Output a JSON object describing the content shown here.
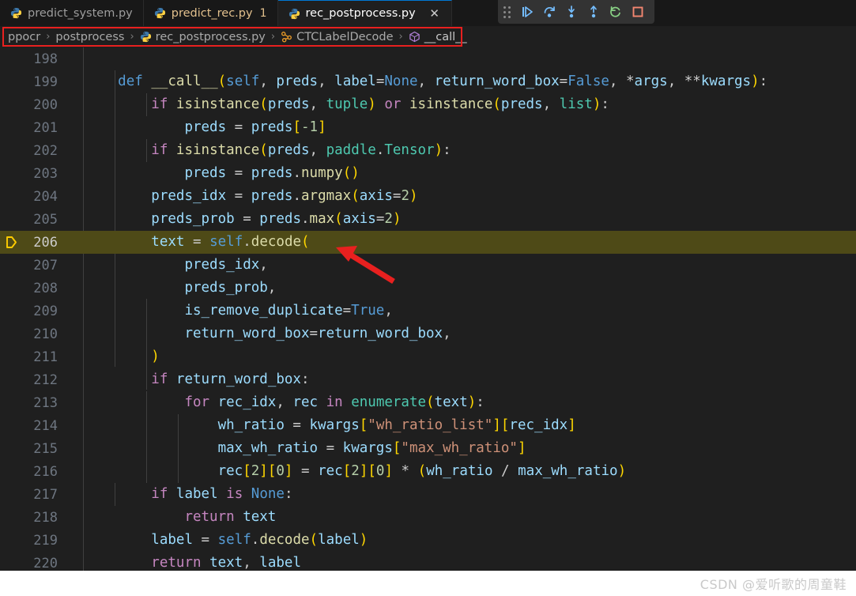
{
  "editor": {
    "theme_bg": "#1f1f1f",
    "tabbar_bg": "#181818",
    "current_line_bg": "#4e4a17",
    "accent": "#0078d4",
    "tabs": [
      {
        "label": "predict_system.py",
        "icon": "python-icon",
        "state": "inactive",
        "badge": ""
      },
      {
        "label": "predict_rec.py",
        "icon": "python-icon",
        "state": "modified",
        "badge": "1"
      },
      {
        "label": "rec_postprocess.py",
        "icon": "python-icon",
        "state": "active",
        "badge": "",
        "close": "✕"
      }
    ],
    "breadcrumb": [
      {
        "label": "ppocr",
        "icon": ""
      },
      {
        "label": "postprocess",
        "icon": ""
      },
      {
        "label": "rec_postprocess.py",
        "icon": "python-icon"
      },
      {
        "label": "CTCLabelDecode",
        "icon": "class-icon"
      },
      {
        "label": "__call__",
        "icon": "method-icon"
      }
    ],
    "breadcrumb_separator": "›",
    "current_line": 206,
    "first_line": 198,
    "lines": [
      {
        "n": 198,
        "tokens": []
      },
      {
        "n": 199,
        "tokens": [
          {
            "t": "    ",
            "c": "pn"
          },
          {
            "t": "def",
            "c": "k"
          },
          {
            "t": " ",
            "c": "pn"
          },
          {
            "t": "__call__",
            "c": "fn"
          },
          {
            "t": "(",
            "c": "br"
          },
          {
            "t": "self",
            "c": "k"
          },
          {
            "t": ", ",
            "c": "pn"
          },
          {
            "t": "preds",
            "c": "va"
          },
          {
            "t": ", ",
            "c": "pn"
          },
          {
            "t": "label",
            "c": "va"
          },
          {
            "t": "=",
            "c": "op"
          },
          {
            "t": "None",
            "c": "k"
          },
          {
            "t": ", ",
            "c": "pn"
          },
          {
            "t": "return_word_box",
            "c": "va"
          },
          {
            "t": "=",
            "c": "op"
          },
          {
            "t": "False",
            "c": "k"
          },
          {
            "t": ", ",
            "c": "pn"
          },
          {
            "t": "*",
            "c": "op"
          },
          {
            "t": "args",
            "c": "va"
          },
          {
            "t": ", ",
            "c": "pn"
          },
          {
            "t": "**",
            "c": "op"
          },
          {
            "t": "kwargs",
            "c": "va"
          },
          {
            "t": ")",
            "c": "br"
          },
          {
            "t": ":",
            "c": "pn"
          }
        ]
      },
      {
        "n": 200,
        "tokens": [
          {
            "t": "        ",
            "c": "pn"
          },
          {
            "t": "if",
            "c": "kc"
          },
          {
            "t": " ",
            "c": "pn"
          },
          {
            "t": "isinstance",
            "c": "fn"
          },
          {
            "t": "(",
            "c": "br"
          },
          {
            "t": "preds",
            "c": "va"
          },
          {
            "t": ", ",
            "c": "pn"
          },
          {
            "t": "tuple",
            "c": "ty"
          },
          {
            "t": ")",
            "c": "br"
          },
          {
            "t": " ",
            "c": "pn"
          },
          {
            "t": "or",
            "c": "kc"
          },
          {
            "t": " ",
            "c": "pn"
          },
          {
            "t": "isinstance",
            "c": "fn"
          },
          {
            "t": "(",
            "c": "br"
          },
          {
            "t": "preds",
            "c": "va"
          },
          {
            "t": ", ",
            "c": "pn"
          },
          {
            "t": "list",
            "c": "ty"
          },
          {
            "t": ")",
            "c": "br"
          },
          {
            "t": ":",
            "c": "pn"
          }
        ]
      },
      {
        "n": 201,
        "tokens": [
          {
            "t": "            ",
            "c": "pn"
          },
          {
            "t": "preds",
            "c": "va"
          },
          {
            "t": " ",
            "c": "pn"
          },
          {
            "t": "=",
            "c": "op"
          },
          {
            "t": " ",
            "c": "pn"
          },
          {
            "t": "preds",
            "c": "va"
          },
          {
            "t": "[",
            "c": "br"
          },
          {
            "t": "-1",
            "c": "nu"
          },
          {
            "t": "]",
            "c": "br"
          }
        ]
      },
      {
        "n": 202,
        "tokens": [
          {
            "t": "        ",
            "c": "pn"
          },
          {
            "t": "if",
            "c": "kc"
          },
          {
            "t": " ",
            "c": "pn"
          },
          {
            "t": "isinstance",
            "c": "fn"
          },
          {
            "t": "(",
            "c": "br"
          },
          {
            "t": "preds",
            "c": "va"
          },
          {
            "t": ", ",
            "c": "pn"
          },
          {
            "t": "paddle",
            "c": "ty"
          },
          {
            "t": ".",
            "c": "pn"
          },
          {
            "t": "Tensor",
            "c": "ty"
          },
          {
            "t": ")",
            "c": "br"
          },
          {
            "t": ":",
            "c": "pn"
          }
        ]
      },
      {
        "n": 203,
        "tokens": [
          {
            "t": "            ",
            "c": "pn"
          },
          {
            "t": "preds",
            "c": "va"
          },
          {
            "t": " ",
            "c": "pn"
          },
          {
            "t": "=",
            "c": "op"
          },
          {
            "t": " ",
            "c": "pn"
          },
          {
            "t": "preds",
            "c": "va"
          },
          {
            "t": ".",
            "c": "pn"
          },
          {
            "t": "numpy",
            "c": "fn"
          },
          {
            "t": "()",
            "c": "br"
          }
        ]
      },
      {
        "n": 204,
        "tokens": [
          {
            "t": "        ",
            "c": "pn"
          },
          {
            "t": "preds_idx",
            "c": "va"
          },
          {
            "t": " ",
            "c": "pn"
          },
          {
            "t": "=",
            "c": "op"
          },
          {
            "t": " ",
            "c": "pn"
          },
          {
            "t": "preds",
            "c": "va"
          },
          {
            "t": ".",
            "c": "pn"
          },
          {
            "t": "argmax",
            "c": "fn"
          },
          {
            "t": "(",
            "c": "br"
          },
          {
            "t": "axis",
            "c": "va"
          },
          {
            "t": "=",
            "c": "op"
          },
          {
            "t": "2",
            "c": "nu"
          },
          {
            "t": ")",
            "c": "br"
          }
        ]
      },
      {
        "n": 205,
        "tokens": [
          {
            "t": "        ",
            "c": "pn"
          },
          {
            "t": "preds_prob",
            "c": "va"
          },
          {
            "t": " ",
            "c": "pn"
          },
          {
            "t": "=",
            "c": "op"
          },
          {
            "t": " ",
            "c": "pn"
          },
          {
            "t": "preds",
            "c": "va"
          },
          {
            "t": ".",
            "c": "pn"
          },
          {
            "t": "max",
            "c": "fn"
          },
          {
            "t": "(",
            "c": "br"
          },
          {
            "t": "axis",
            "c": "va"
          },
          {
            "t": "=",
            "c": "op"
          },
          {
            "t": "2",
            "c": "nu"
          },
          {
            "t": ")",
            "c": "br"
          }
        ]
      },
      {
        "n": 206,
        "tokens": [
          {
            "t": "        ",
            "c": "pn"
          },
          {
            "t": "text",
            "c": "va"
          },
          {
            "t": " ",
            "c": "pn"
          },
          {
            "t": "=",
            "c": "op"
          },
          {
            "t": " ",
            "c": "pn"
          },
          {
            "t": "self",
            "c": "k"
          },
          {
            "t": ".",
            "c": "pn"
          },
          {
            "t": "decode",
            "c": "fn"
          },
          {
            "t": "(",
            "c": "br"
          }
        ]
      },
      {
        "n": 207,
        "tokens": [
          {
            "t": "            ",
            "c": "pn"
          },
          {
            "t": "preds_idx",
            "c": "va"
          },
          {
            "t": ",",
            "c": "pn"
          }
        ]
      },
      {
        "n": 208,
        "tokens": [
          {
            "t": "            ",
            "c": "pn"
          },
          {
            "t": "preds_prob",
            "c": "va"
          },
          {
            "t": ",",
            "c": "pn"
          }
        ]
      },
      {
        "n": 209,
        "tokens": [
          {
            "t": "            ",
            "c": "pn"
          },
          {
            "t": "is_remove_duplicate",
            "c": "va"
          },
          {
            "t": "=",
            "c": "op"
          },
          {
            "t": "True",
            "c": "k"
          },
          {
            "t": ",",
            "c": "pn"
          }
        ]
      },
      {
        "n": 210,
        "tokens": [
          {
            "t": "            ",
            "c": "pn"
          },
          {
            "t": "return_word_box",
            "c": "va"
          },
          {
            "t": "=",
            "c": "op"
          },
          {
            "t": "return_word_box",
            "c": "va"
          },
          {
            "t": ",",
            "c": "pn"
          }
        ]
      },
      {
        "n": 211,
        "tokens": [
          {
            "t": "        ",
            "c": "pn"
          },
          {
            "t": ")",
            "c": "br"
          }
        ]
      },
      {
        "n": 212,
        "tokens": [
          {
            "t": "        ",
            "c": "pn"
          },
          {
            "t": "if",
            "c": "kc"
          },
          {
            "t": " ",
            "c": "pn"
          },
          {
            "t": "return_word_box",
            "c": "va"
          },
          {
            "t": ":",
            "c": "pn"
          }
        ]
      },
      {
        "n": 213,
        "tokens": [
          {
            "t": "            ",
            "c": "pn"
          },
          {
            "t": "for",
            "c": "kc"
          },
          {
            "t": " ",
            "c": "pn"
          },
          {
            "t": "rec_idx",
            "c": "va"
          },
          {
            "t": ", ",
            "c": "pn"
          },
          {
            "t": "rec",
            "c": "va"
          },
          {
            "t": " ",
            "c": "pn"
          },
          {
            "t": "in",
            "c": "kc"
          },
          {
            "t": " ",
            "c": "pn"
          },
          {
            "t": "enumerate",
            "c": "ty"
          },
          {
            "t": "(",
            "c": "br"
          },
          {
            "t": "text",
            "c": "va"
          },
          {
            "t": ")",
            "c": "br"
          },
          {
            "t": ":",
            "c": "pn"
          }
        ]
      },
      {
        "n": 214,
        "tokens": [
          {
            "t": "                ",
            "c": "pn"
          },
          {
            "t": "wh_ratio",
            "c": "va"
          },
          {
            "t": " ",
            "c": "pn"
          },
          {
            "t": "=",
            "c": "op"
          },
          {
            "t": " ",
            "c": "pn"
          },
          {
            "t": "kwargs",
            "c": "va"
          },
          {
            "t": "[",
            "c": "br"
          },
          {
            "t": "\"wh_ratio_list\"",
            "c": "st"
          },
          {
            "t": "]",
            "c": "br"
          },
          {
            "t": "[",
            "c": "br"
          },
          {
            "t": "rec_idx",
            "c": "va"
          },
          {
            "t": "]",
            "c": "br"
          }
        ]
      },
      {
        "n": 215,
        "tokens": [
          {
            "t": "                ",
            "c": "pn"
          },
          {
            "t": "max_wh_ratio",
            "c": "va"
          },
          {
            "t": " ",
            "c": "pn"
          },
          {
            "t": "=",
            "c": "op"
          },
          {
            "t": " ",
            "c": "pn"
          },
          {
            "t": "kwargs",
            "c": "va"
          },
          {
            "t": "[",
            "c": "br"
          },
          {
            "t": "\"max_wh_ratio\"",
            "c": "st"
          },
          {
            "t": "]",
            "c": "br"
          }
        ]
      },
      {
        "n": 216,
        "tokens": [
          {
            "t": "                ",
            "c": "pn"
          },
          {
            "t": "rec",
            "c": "va"
          },
          {
            "t": "[",
            "c": "br"
          },
          {
            "t": "2",
            "c": "nu"
          },
          {
            "t": "]",
            "c": "br"
          },
          {
            "t": "[",
            "c": "br"
          },
          {
            "t": "0",
            "c": "nu"
          },
          {
            "t": "]",
            "c": "br"
          },
          {
            "t": " ",
            "c": "pn"
          },
          {
            "t": "=",
            "c": "op"
          },
          {
            "t": " ",
            "c": "pn"
          },
          {
            "t": "rec",
            "c": "va"
          },
          {
            "t": "[",
            "c": "br"
          },
          {
            "t": "2",
            "c": "nu"
          },
          {
            "t": "]",
            "c": "br"
          },
          {
            "t": "[",
            "c": "br"
          },
          {
            "t": "0",
            "c": "nu"
          },
          {
            "t": "]",
            "c": "br"
          },
          {
            "t": " ",
            "c": "pn"
          },
          {
            "t": "*",
            "c": "op"
          },
          {
            "t": " ",
            "c": "pn"
          },
          {
            "t": "(",
            "c": "br"
          },
          {
            "t": "wh_ratio",
            "c": "va"
          },
          {
            "t": " ",
            "c": "pn"
          },
          {
            "t": "/",
            "c": "op"
          },
          {
            "t": " ",
            "c": "pn"
          },
          {
            "t": "max_wh_ratio",
            "c": "va"
          },
          {
            "t": ")",
            "c": "br"
          }
        ]
      },
      {
        "n": 217,
        "tokens": [
          {
            "t": "        ",
            "c": "pn"
          },
          {
            "t": "if",
            "c": "kc"
          },
          {
            "t": " ",
            "c": "pn"
          },
          {
            "t": "label",
            "c": "va"
          },
          {
            "t": " ",
            "c": "pn"
          },
          {
            "t": "is",
            "c": "kc"
          },
          {
            "t": " ",
            "c": "pn"
          },
          {
            "t": "None",
            "c": "k"
          },
          {
            "t": ":",
            "c": "pn"
          }
        ]
      },
      {
        "n": 218,
        "tokens": [
          {
            "t": "            ",
            "c": "pn"
          },
          {
            "t": "return",
            "c": "kc"
          },
          {
            "t": " ",
            "c": "pn"
          },
          {
            "t": "text",
            "c": "va"
          }
        ]
      },
      {
        "n": 219,
        "tokens": [
          {
            "t": "        ",
            "c": "pn"
          },
          {
            "t": "label",
            "c": "va"
          },
          {
            "t": " ",
            "c": "pn"
          },
          {
            "t": "=",
            "c": "op"
          },
          {
            "t": " ",
            "c": "pn"
          },
          {
            "t": "self",
            "c": "k"
          },
          {
            "t": ".",
            "c": "pn"
          },
          {
            "t": "decode",
            "c": "fn"
          },
          {
            "t": "(",
            "c": "br"
          },
          {
            "t": "label",
            "c": "va"
          },
          {
            "t": ")",
            "c": "br"
          }
        ]
      },
      {
        "n": 220,
        "tokens": [
          {
            "t": "        ",
            "c": "pn"
          },
          {
            "t": "return",
            "c": "kc"
          },
          {
            "t": " ",
            "c": "pn"
          },
          {
            "t": "text",
            "c": "va"
          },
          {
            "t": ", ",
            "c": "pn"
          },
          {
            "t": "label",
            "c": "va"
          }
        ]
      }
    ]
  },
  "debug_toolbar": {
    "buttons": [
      {
        "name": "drag-handle",
        "title": "Drag",
        "icon": "grip-icon"
      },
      {
        "name": "continue-button",
        "title": "Continue",
        "icon": "continue-icon"
      },
      {
        "name": "step-over-button",
        "title": "Step Over",
        "icon": "step-over-icon"
      },
      {
        "name": "step-into-button",
        "title": "Step Into",
        "icon": "step-into-icon"
      },
      {
        "name": "step-out-button",
        "title": "Step Out",
        "icon": "step-out-icon"
      },
      {
        "name": "restart-button",
        "title": "Restart",
        "icon": "restart-icon"
      },
      {
        "name": "stop-button",
        "title": "Stop",
        "icon": "stop-icon"
      }
    ]
  },
  "annotations": {
    "breadcrumb_highlight_color": "#e8201f",
    "arrow_color": "#e8201f",
    "arrow_target": "line 206 decode("
  },
  "footer": {
    "watermark": "CSDN @爱听歌的周童鞋"
  }
}
